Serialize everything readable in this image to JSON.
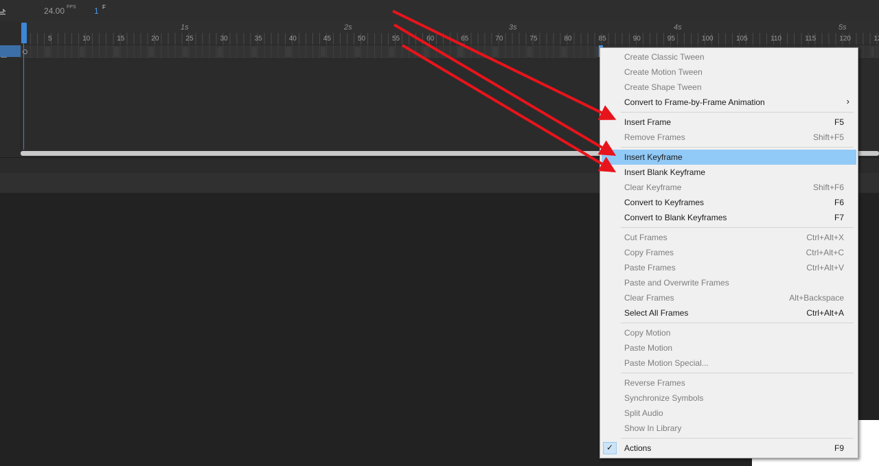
{
  "timeline": {
    "fps_value": "24.00",
    "fps_unit": "FPS",
    "current_frame": "1",
    "frame_unit": "F",
    "second_labels": [
      "1s",
      "2s",
      "3s",
      "4s",
      "5s"
    ],
    "frame_numbers": [
      "5",
      "10",
      "15",
      "20",
      "25",
      "30",
      "35",
      "40",
      "45",
      "50",
      "55",
      "60",
      "65",
      "70",
      "75",
      "80",
      "85",
      "90",
      "95",
      "100",
      "105",
      "110",
      "115",
      "120",
      "12"
    ]
  },
  "context_menu": {
    "items": [
      {
        "label": "Create Classic Tween",
        "shortcut": "",
        "disabled": true
      },
      {
        "label": "Create Motion Tween",
        "shortcut": "",
        "disabled": true
      },
      {
        "label": "Create Shape Tween",
        "shortcut": "",
        "disabled": true
      },
      {
        "label": "Convert to Frame-by-Frame Animation",
        "shortcut": "",
        "disabled": false,
        "submenu": true,
        "submenu_glyph": "›"
      },
      {
        "label": "Insert Frame",
        "shortcut": "F5",
        "disabled": false
      },
      {
        "label": "Remove Frames",
        "shortcut": "Shift+F5",
        "disabled": true
      },
      {
        "label": "Insert Keyframe",
        "shortcut": "",
        "disabled": false,
        "highlighted": true
      },
      {
        "label": "Insert Blank Keyframe",
        "shortcut": "",
        "disabled": false
      },
      {
        "label": "Clear Keyframe",
        "shortcut": "Shift+F6",
        "disabled": true
      },
      {
        "label": "Convert to Keyframes",
        "shortcut": "F6",
        "disabled": false
      },
      {
        "label": "Convert to Blank Keyframes",
        "shortcut": "F7",
        "disabled": false
      },
      {
        "label": "Cut Frames",
        "shortcut": "Ctrl+Alt+X",
        "disabled": true
      },
      {
        "label": "Copy Frames",
        "shortcut": "Ctrl+Alt+C",
        "disabled": true
      },
      {
        "label": "Paste Frames",
        "shortcut": "Ctrl+Alt+V",
        "disabled": true
      },
      {
        "label": "Paste and Overwrite Frames",
        "shortcut": "",
        "disabled": true
      },
      {
        "label": "Clear Frames",
        "shortcut": "Alt+Backspace",
        "disabled": true
      },
      {
        "label": "Select All Frames",
        "shortcut": "Ctrl+Alt+A",
        "disabled": false
      },
      {
        "label": "Copy Motion",
        "shortcut": "",
        "disabled": true
      },
      {
        "label": "Paste Motion",
        "shortcut": "",
        "disabled": true
      },
      {
        "label": "Paste Motion Special...",
        "shortcut": "",
        "disabled": true
      },
      {
        "label": "Reverse Frames",
        "shortcut": "",
        "disabled": true
      },
      {
        "label": "Synchronize Symbols",
        "shortcut": "",
        "disabled": true
      },
      {
        "label": "Split Audio",
        "shortcut": "",
        "disabled": true
      },
      {
        "label": "Show In Library",
        "shortcut": "",
        "disabled": true
      },
      {
        "label": "Actions",
        "shortcut": "F9",
        "disabled": false,
        "checked": true,
        "check_glyph": "✓"
      }
    ]
  },
  "colors": {
    "annotation_arrow": "#e8141b",
    "highlight": "#91c9f7",
    "playhead": "#3d86d8"
  }
}
